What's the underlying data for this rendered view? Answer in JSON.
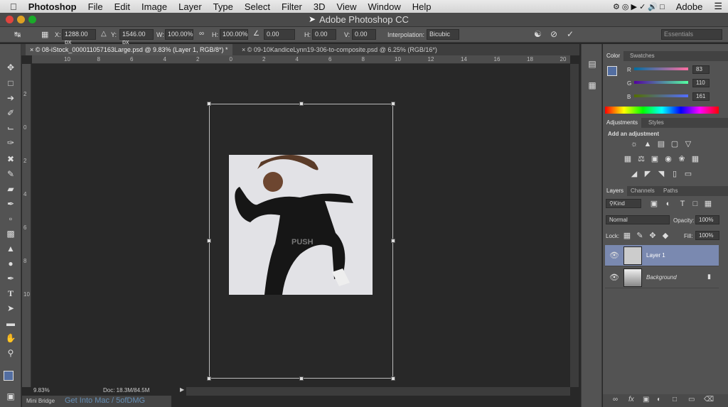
{
  "menu": {
    "app": "Photoshop",
    "items": [
      "File",
      "Edit",
      "Image",
      "Layer",
      "Type",
      "Select",
      "Filter",
      "3D",
      "View",
      "Window",
      "Help"
    ],
    "right": "Adobe"
  },
  "window": {
    "title": "Adobe Photoshop CC"
  },
  "options": {
    "x_label": "X:",
    "x": "1288.00 px",
    "y_label": "Y:",
    "y": "1546.00 px",
    "w_label": "W:",
    "w": "100.00%",
    "h_label": "H:",
    "h": "100.00%",
    "angle": "0.00",
    "hskew_label": "H:",
    "hskew": "0.00",
    "vskew_label": "V:",
    "vskew": "0.00",
    "interp_label": "Interpolation:",
    "interp": "Bicubic",
    "workspace": "Essentials"
  },
  "tabs": [
    {
      "label": "© 08-iStock_000011057163Large.psd @ 9.83% (Layer 1, RGB/8*) *"
    },
    {
      "label": "© 09-10KandiceLynn19-306-to-composite.psd @ 6.25% (RGB/16*)"
    }
  ],
  "ruler": {
    "h": [
      "10",
      "8",
      "6",
      "4",
      "2",
      "0",
      "2",
      "4",
      "6",
      "8",
      "10",
      "12",
      "14",
      "16",
      "18",
      "20",
      "22"
    ],
    "v": [
      "2",
      "0",
      "2",
      "4",
      "6",
      "8",
      "10"
    ]
  },
  "status": {
    "zoom": "9.83%",
    "doc": "Doc: 18.3M/84.5M"
  },
  "minibridge": {
    "label": "Mini Bridge",
    "watermark": "Get Into Mac / 5ofDMG"
  },
  "color": {
    "tabs": [
      "Color",
      "Swatches"
    ],
    "r_label": "R",
    "g_label": "G",
    "b_label": "B",
    "r": "83",
    "g": "110",
    "b": "161",
    "swatch": "#536ea1"
  },
  "adjustments": {
    "tabs": [
      "Adjustments",
      "Styles"
    ],
    "heading": "Add an adjustment"
  },
  "layers": {
    "tabs": [
      "Layers",
      "Channels",
      "Paths"
    ],
    "kind": "Kind",
    "blend": "Normal",
    "opacity_label": "Opacity:",
    "opacity": "100%",
    "lock_label": "Lock:",
    "fill_label": "Fill:",
    "fill": "100%",
    "items": [
      {
        "name": "Layer 1"
      },
      {
        "name": "Background"
      }
    ]
  }
}
